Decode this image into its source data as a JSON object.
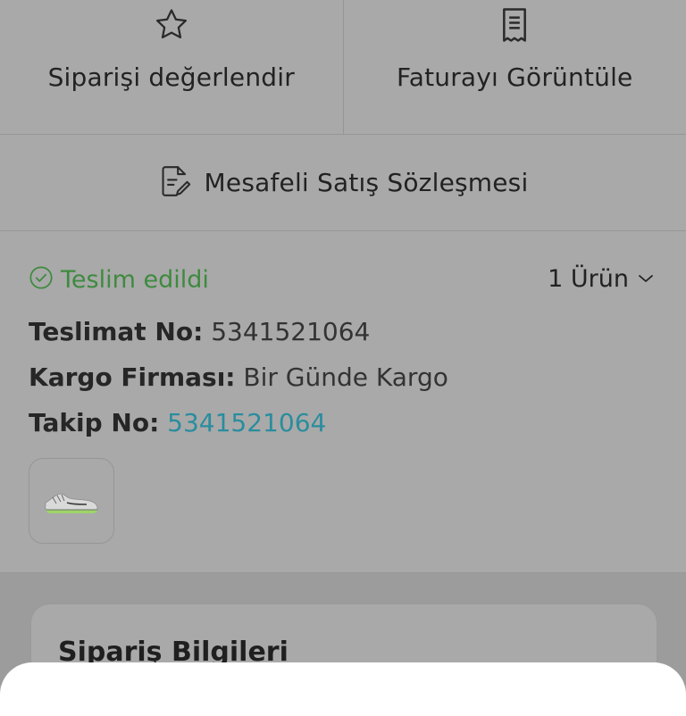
{
  "actions": {
    "rate_label": "Siparişi değerlendir",
    "rate_icon": "star-icon",
    "invoice_label": "Faturayı Görüntüle",
    "invoice_icon": "receipt-icon"
  },
  "contract": {
    "label": "Mesafeli Satış Sözleşmesi",
    "icon": "document-edit-icon"
  },
  "delivery": {
    "status": "Teslim edildi",
    "status_icon": "check-circle-icon",
    "status_color": "#3e8a3f",
    "item_count": "1 Ürün",
    "expand_icon": "chevron-down-icon",
    "delivery_no_label": "Teslimat No:",
    "delivery_no_value": "5341521064",
    "carrier_label": "Kargo Firması:",
    "carrier_value": "Bir Günde Kargo",
    "tracking_label": "Takip No:",
    "tracking_value": "5341521064",
    "link_color": "#2a8d9d",
    "product_image": "running-shoe-thumbnail"
  },
  "order_info": {
    "title": "Sipariş Bilgileri"
  }
}
